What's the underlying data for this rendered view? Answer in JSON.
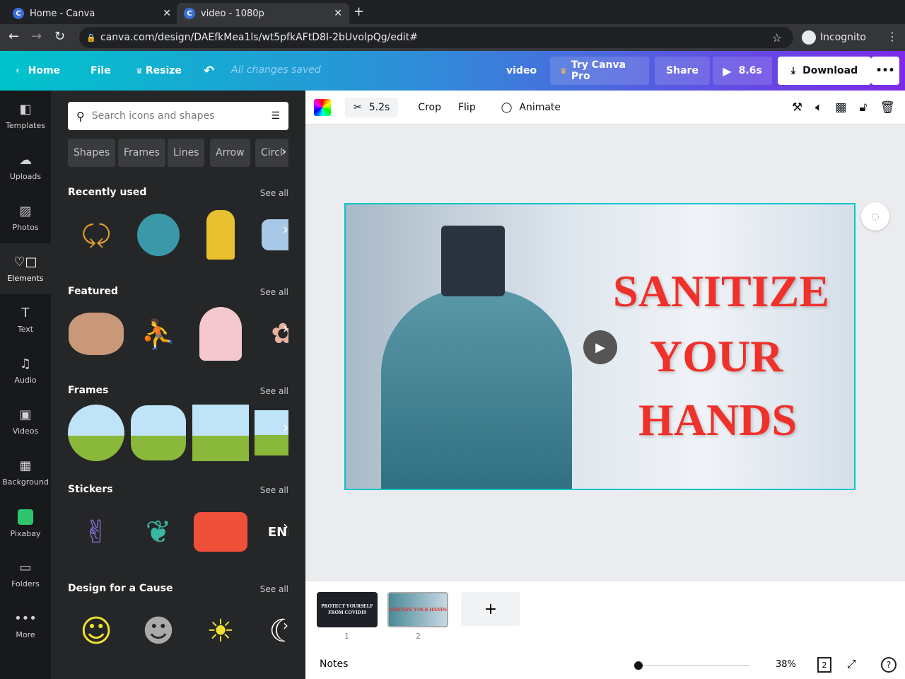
{
  "browser": {
    "tabs": [
      {
        "title": "Home - Canva"
      },
      {
        "title": "video - 1080p"
      }
    ],
    "url": "canva.com/design/DAEfkMea1ls/wt5pfkAFtD8I-2bUvolpQg/edit#",
    "profile": "Incognito"
  },
  "header": {
    "home": "Home",
    "file": "File",
    "resize": "Resize",
    "status": "All changes saved",
    "doc_title": "video",
    "try_pro": "Try Canva Pro",
    "share": "Share",
    "play_duration": "8.6s",
    "download": "Download",
    "more": "•••"
  },
  "rail": [
    {
      "label": "Templates"
    },
    {
      "label": "Uploads"
    },
    {
      "label": "Photos"
    },
    {
      "label": "Elements"
    },
    {
      "label": "Text"
    },
    {
      "label": "Audio"
    },
    {
      "label": "Videos"
    },
    {
      "label": "Background"
    },
    {
      "label": "Pixabay"
    },
    {
      "label": "Folders"
    },
    {
      "label": "More"
    }
  ],
  "panel": {
    "search_placeholder": "Search icons and shapes",
    "chips": [
      "Shapes",
      "Frames",
      "Lines",
      "Arrow",
      "Circl"
    ],
    "sections": [
      {
        "title": "Recently used",
        "see_all": "See all"
      },
      {
        "title": "Featured",
        "see_all": "See all"
      },
      {
        "title": "Frames",
        "see_all": "See all"
      },
      {
        "title": "Stickers",
        "see_all": "See all"
      },
      {
        "title": "Design for a Cause",
        "see_all": "See all"
      }
    ]
  },
  "toolbar": {
    "duration": "5.2s",
    "crop": "Crop",
    "flip": "Flip",
    "animate": "Animate"
  },
  "canvas": {
    "lines": [
      "SANITIZE",
      "YOUR",
      "HANDS"
    ]
  },
  "pages": [
    {
      "number": "1",
      "text": "PROTECT YOURSELF FROM COVID19"
    },
    {
      "number": "2",
      "text": "SANITIZE YOUR HANDS"
    }
  ],
  "footer": {
    "notes": "Notes",
    "zoom": "38%",
    "zoom_fraction": 0.02,
    "page_count": "2",
    "help": "?"
  },
  "colors": {
    "accent": "#00c4cc",
    "purple": "#7d2ae8",
    "headline": "#f0302a"
  }
}
